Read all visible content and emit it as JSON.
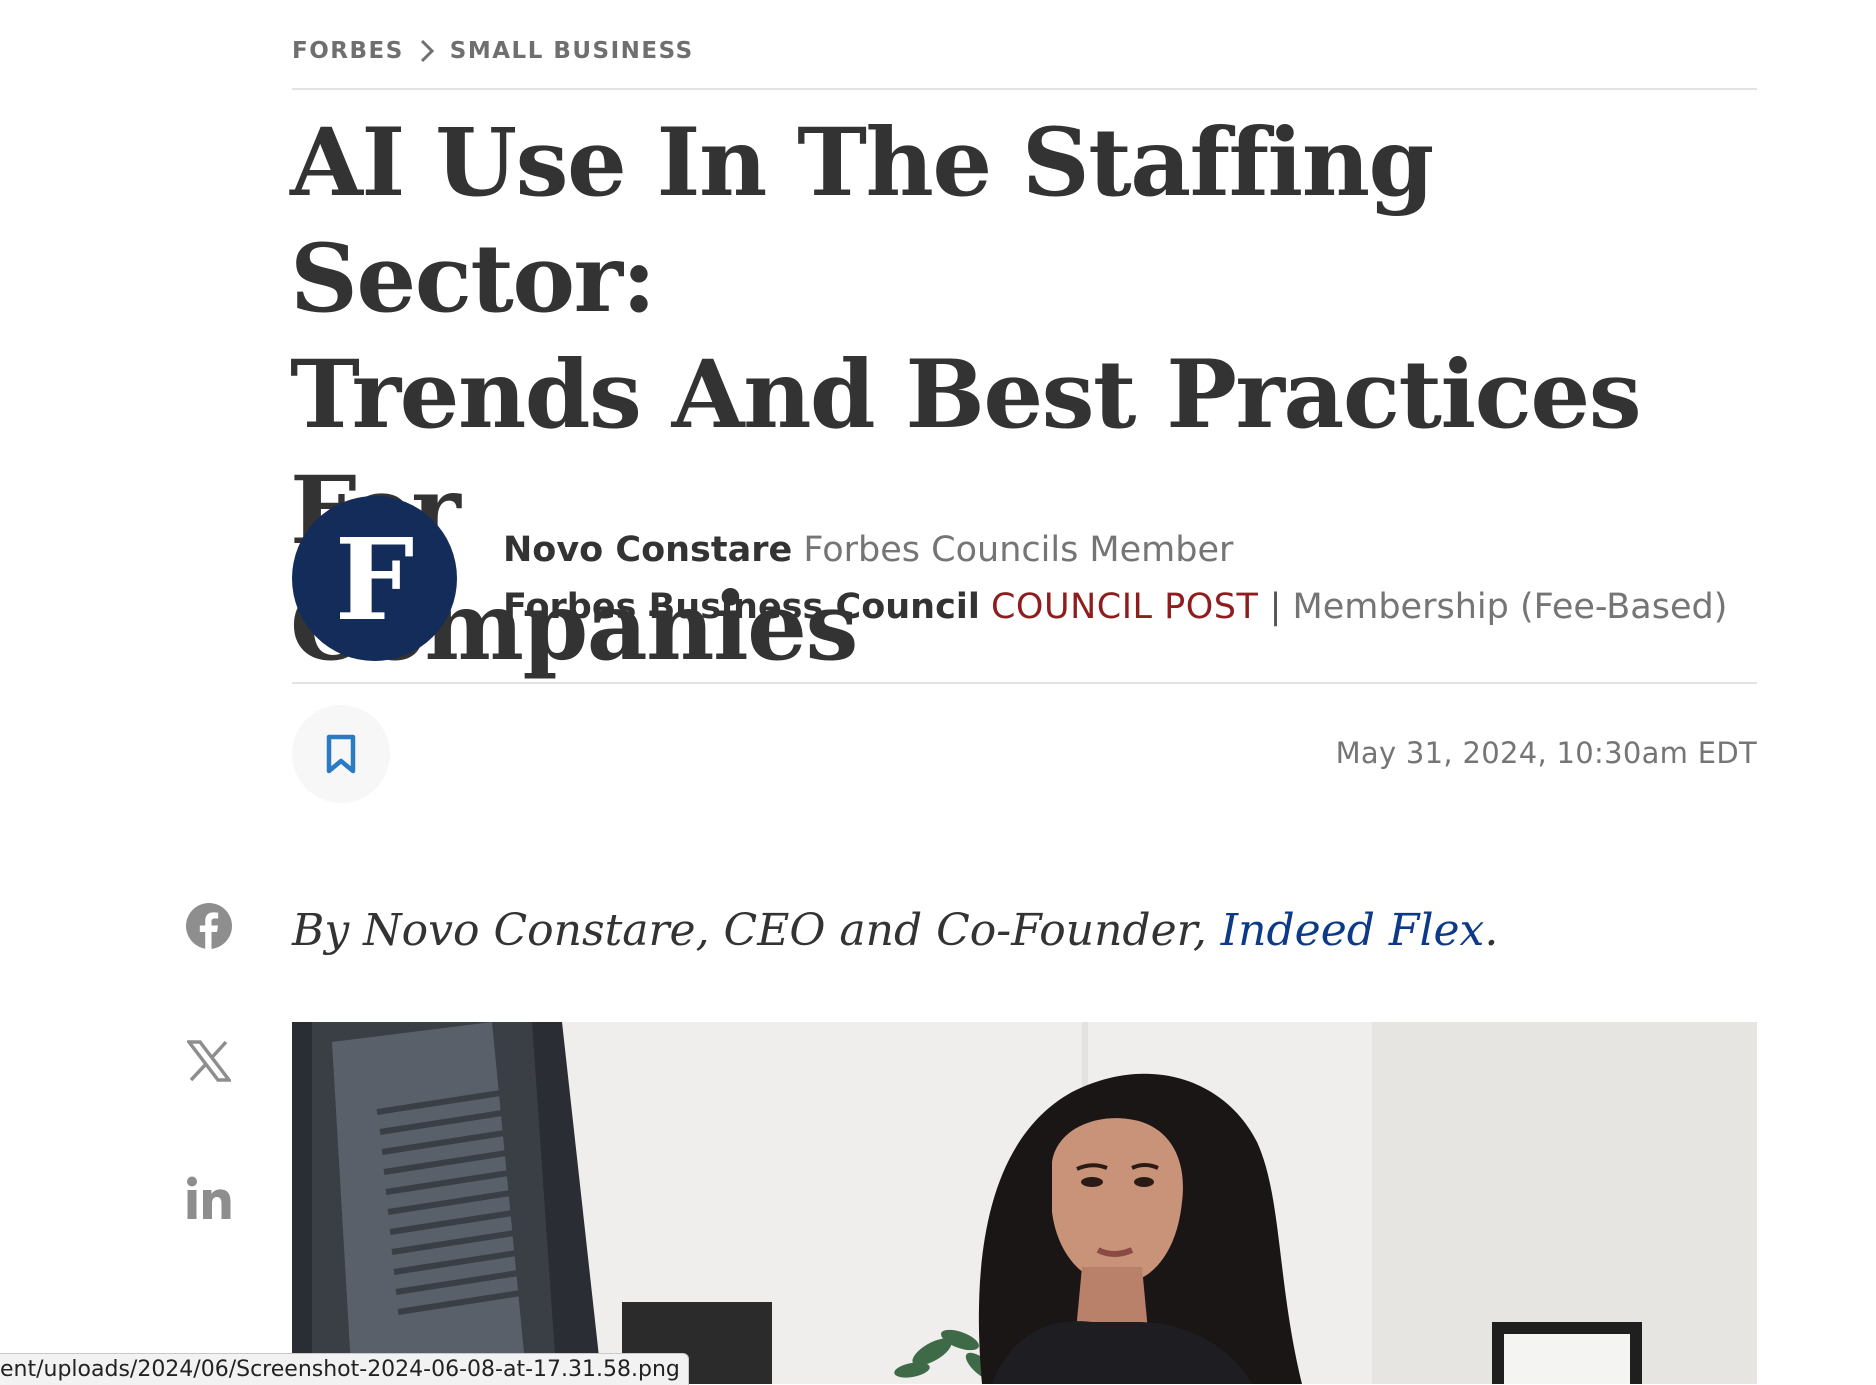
{
  "breadcrumb": {
    "section": "FORBES",
    "subsection": "SMALL BUSINESS"
  },
  "article": {
    "headline_line1": "AI Use In The Staffing Sector:",
    "headline_line2": "Trends And Best Practices For",
    "headline_line3": "Companies",
    "date": "May 31, 2024, 10:30am EDT"
  },
  "author": {
    "avatar_letter": "F",
    "name": "Novo Constare",
    "role": "Forbes Councils Member",
    "council": "Forbes Business Council",
    "post_type": "COUNCIL POST",
    "separator": "|",
    "membership": "Membership (Fee-Based)"
  },
  "byline": {
    "prefix": "By Novo Constare, CEO and Co-Founder, ",
    "company": "Indeed Flex",
    "suffix": "."
  },
  "social": [
    "facebook-icon",
    "x-icon",
    "linkedin-icon"
  ],
  "status_bar": {
    "url": "ent/uploads/2024/06/Screenshot-2024-06-08-at-17.31.58.png"
  },
  "colors": {
    "avatar_bg": "#142c5a",
    "council_post": "#8f1d1d",
    "link": "#0c3a88",
    "bookmark": "#2a7ac4"
  }
}
